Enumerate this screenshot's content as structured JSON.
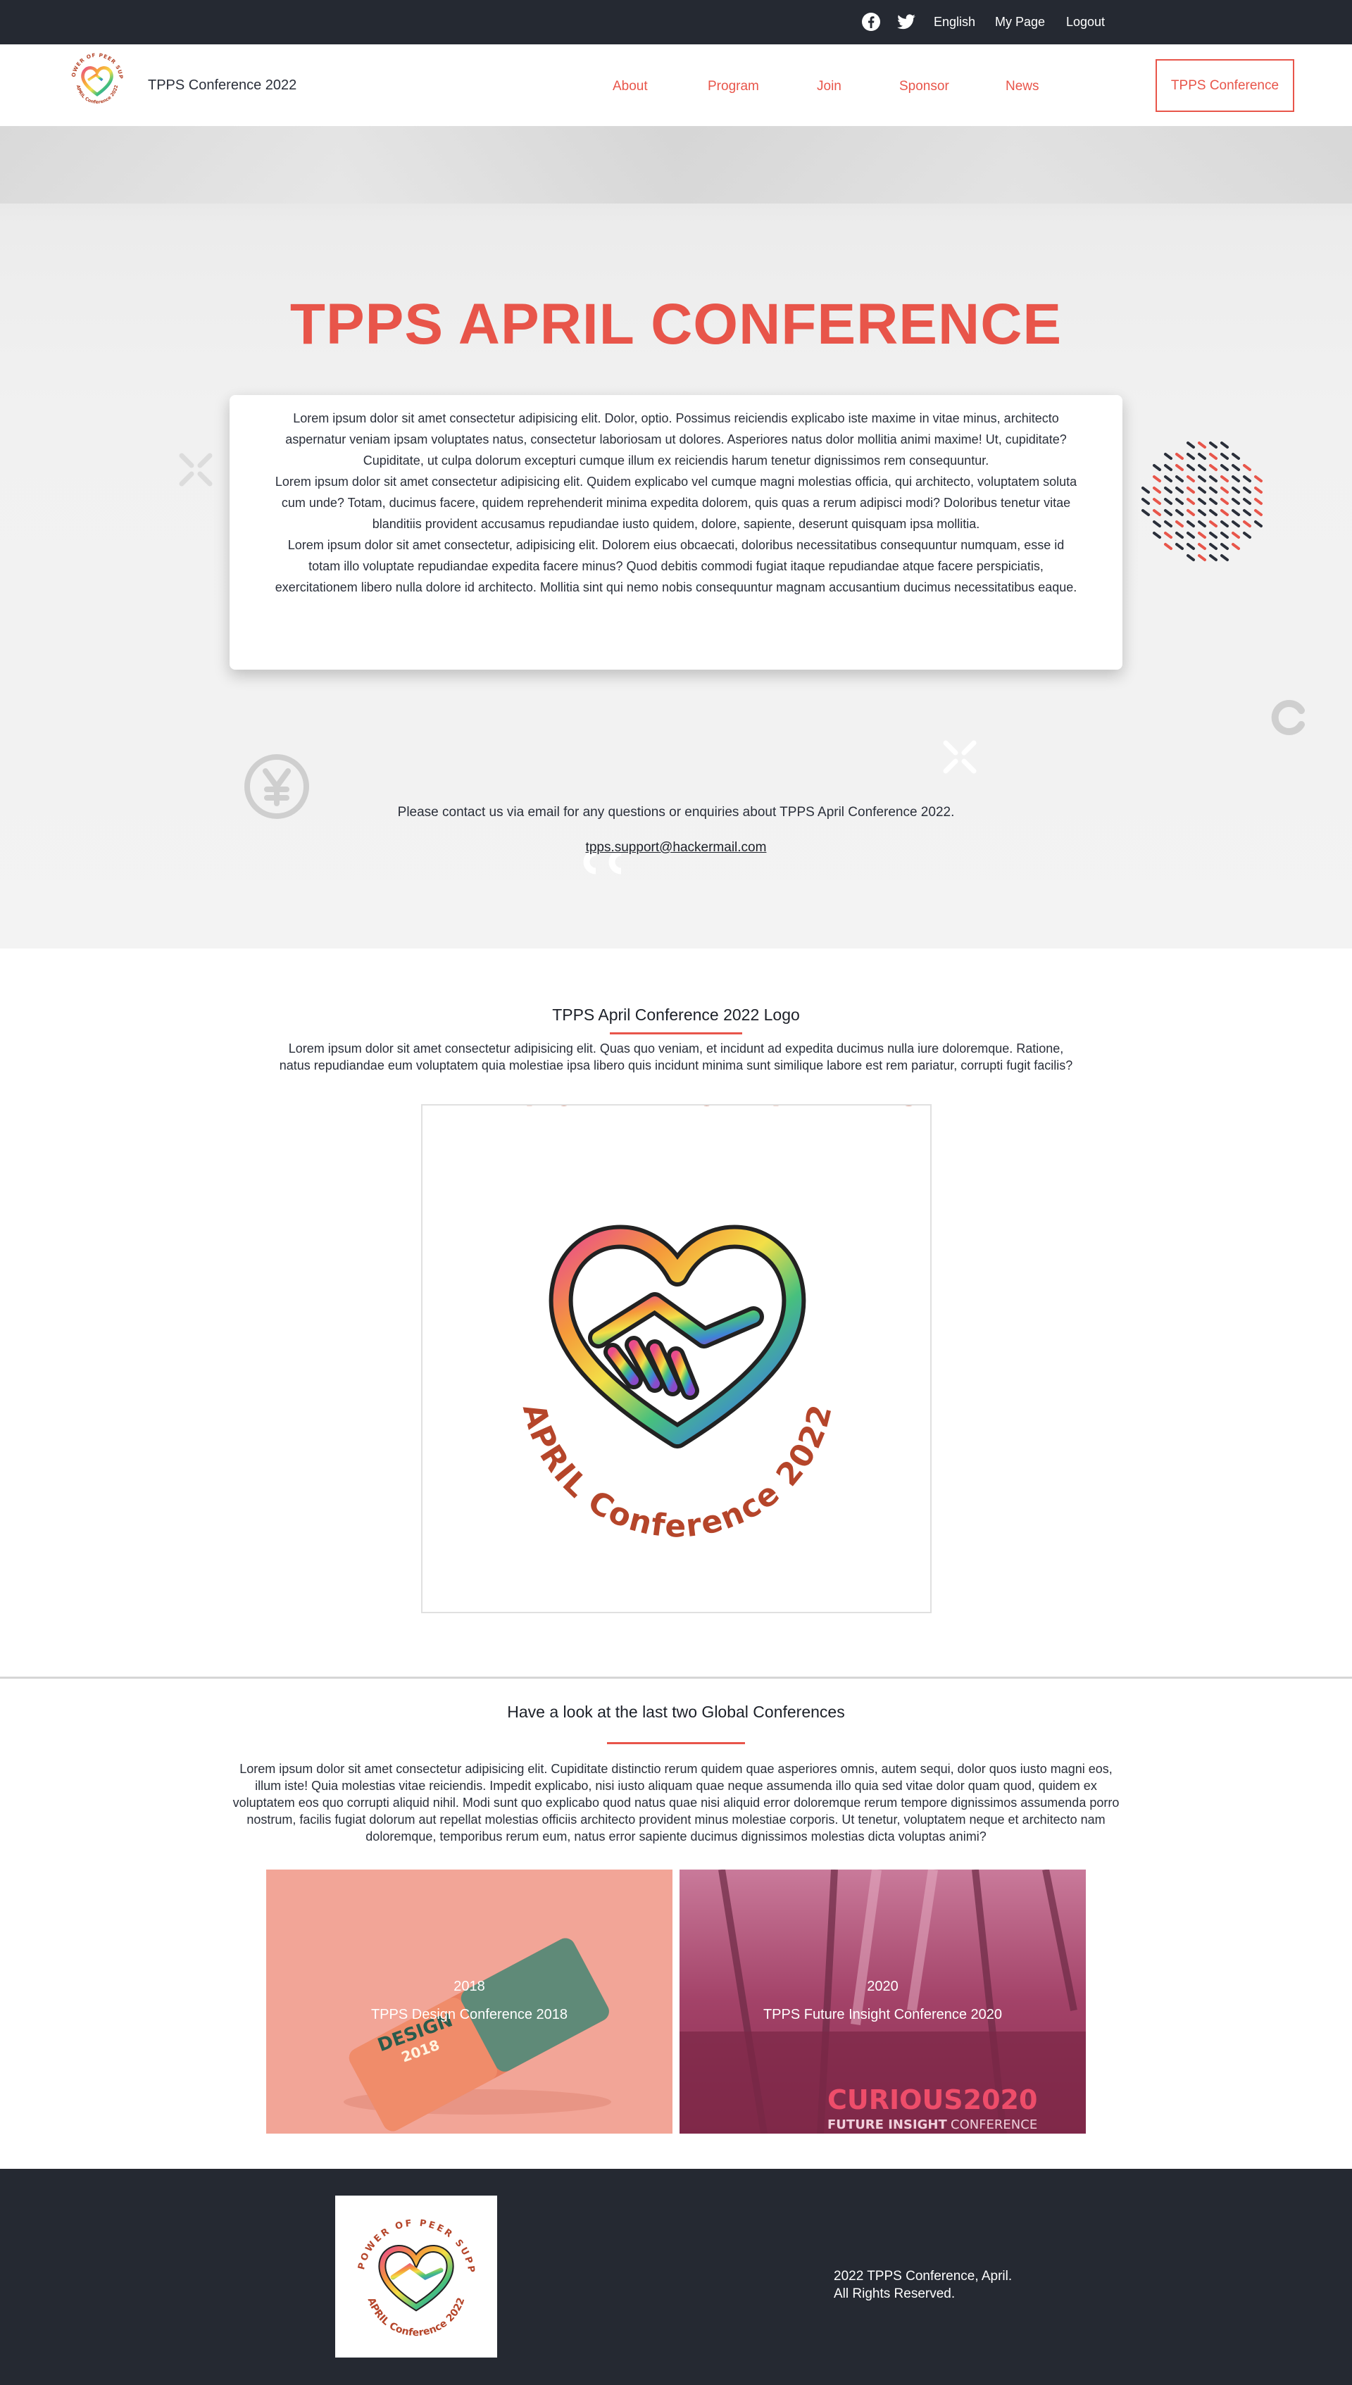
{
  "topbar": {
    "icons": [
      "facebook-icon",
      "twitter-icon"
    ],
    "language": "English",
    "my_page": "My Page",
    "logout": "Logout"
  },
  "header": {
    "brand_name": "TPPS Conference 2022",
    "nav": [
      "About",
      "Program",
      "Join",
      "Sponsor",
      "News"
    ],
    "cta": "TPPS Conference"
  },
  "hero": {
    "title": "TPPS APRIL CONFERENCE",
    "paragraphs": [
      "Lorem ipsum dolor sit amet consectetur adipisicing elit. Dolor, optio. Possimus reiciendis explicabo iste maxime in vitae minus, architecto aspernatur veniam ipsam voluptates natus, consectetur laboriosam ut dolores. Asperiores natus dolor mollitia animi maxime! Ut, cupiditate? Cupiditate, ut culpa dolorum excepturi cumque illum ex reiciendis harum tenetur dignissimos rem consequuntur.",
      "Lorem ipsum dolor sit amet consectetur adipisicing elit. Quidem explicabo vel cumque magni molestias officia, qui architecto, voluptatem soluta cum unde? Totam, ducimus facere, quidem reprehenderit minima expedita dolorem, quis quas a rerum adipisci modi? Doloribus tenetur vitae blanditiis provident accusamus repudiandae iusto quidem, dolore, sapiente, deserunt quisquam ipsa mollitia.",
      "Lorem ipsum dolor sit amet consectetur, adipisicing elit. Dolorem eius obcaecati, doloribus necessitatibus consequuntur numquam, esse id totam illo voluptate repudiandae expedita facere minus? Quod debitis commodi fugiat itaque repudiandae atque facere perspiciatis, exercitationem libero nulla dolore id architecto. Mollitia sint qui nemo nobis consequuntur magnam accusantium ducimus necessitatibus eaque."
    ],
    "contact_text": "Please contact us via email for any questions or enquiries about TPPS April Conference 2022.",
    "contact_email": "tpps.support@hackermail.com"
  },
  "logo_section": {
    "title": "TPPS April Conference 2022 Logo",
    "text": "Lorem ipsum dolor sit amet consectetur adipisicing elit. Quas quo veniam, et incidunt ad expedita ducimus nulla iure doloremque. Ratione, natus repudiandae eum voluptatem quia molestiae ipsa libero quis incidunt minima sunt similique labore est rem pariatur, corrupti fugit facilis?",
    "logo_top_text": "THE POWER OF PEER SUPPORT",
    "logo_bottom_text": "APRIL Conference 2022"
  },
  "global_section": {
    "title": "Have a look at the last two Global Conferences",
    "text": "Lorem ipsum dolor sit amet consectetur adipisicing elit. Cupiditate distinctio rerum quidem quae asperiores omnis, autem sequi, dolor quos iusto magni eos, illum iste! Quia molestias vitae reiciendis. Impedit explicabo, nisi iusto aliquam quae neque assumenda illo quia sed vitae dolor quam quod, quidem ex voluptatem eos quo corrupti aliquid nihil. Modi sunt quo explicabo quod natus quae nisi aliquid error doloremque rerum tempore dignissimos assumenda porro nostrum, facilis fugiat dolorum aut repellat molestias officiis architecto provident minus molestiae corporis. Ut tenetur, voluptatem neque et architecto nam doloremque, temporibus rerum eum, natus error sapiente ducimus dignissimos molestias dicta voluptas animi?",
    "cards": [
      {
        "year": "2018",
        "name": "TPPS Design Conference 2018",
        "art_text": "DESIGN",
        "art_year": "2018"
      },
      {
        "year": "2020",
        "name": "TPPS Future Insight Conference 2020",
        "art_title": "CURIOUS2020",
        "art_subtitle_bold": "FUTURE INSIGHT",
        "art_subtitle": "CONFERENCE"
      }
    ]
  },
  "footer": {
    "copyright_line1": "2022 TPPS Conference, April.",
    "copyright_line2": "All Rights Reserved."
  },
  "colors": {
    "accent": "#e8554a",
    "dark": "#252932",
    "logo_brown": "#b5452a"
  }
}
